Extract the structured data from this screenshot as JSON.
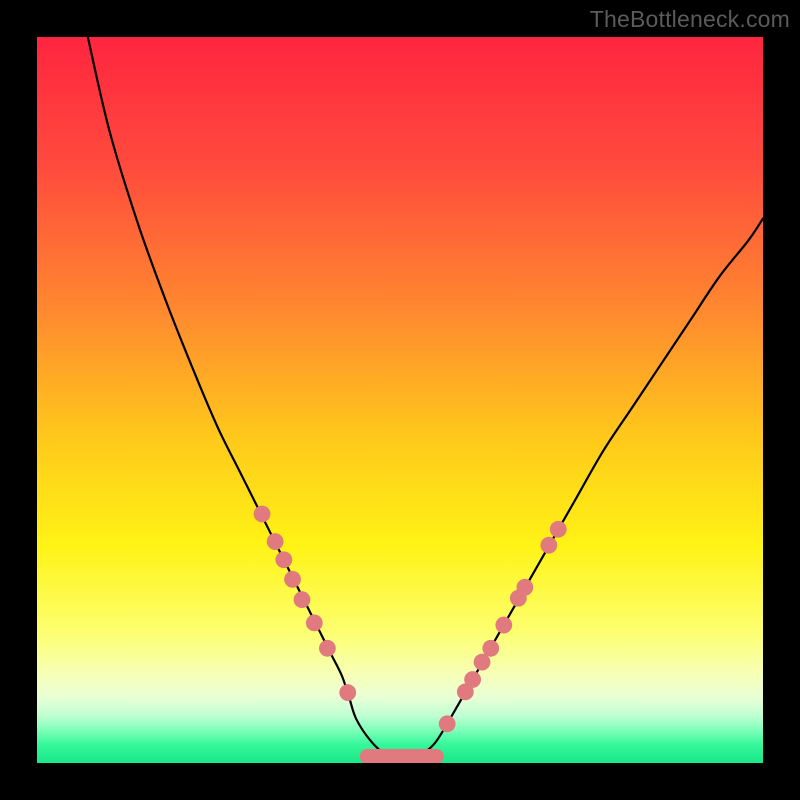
{
  "watermark": "TheBottleneck.com",
  "colors": {
    "black": "#000000",
    "curve": "#000000",
    "marker_fill": "#e07a7e",
    "marker_stroke": "#cf6b6f"
  },
  "gradient_stops": [
    {
      "pct": 0,
      "color": "#ff253f"
    },
    {
      "pct": 18,
      "color": "#ff4b3d"
    },
    {
      "pct": 38,
      "color": "#ff8a2f"
    },
    {
      "pct": 55,
      "color": "#ffc81b"
    },
    {
      "pct": 70,
      "color": "#fff315"
    },
    {
      "pct": 82,
      "color": "#fdff70"
    },
    {
      "pct": 88,
      "color": "#f6ffb9"
    },
    {
      "pct": 91,
      "color": "#e8ffd6"
    },
    {
      "pct": 93.5,
      "color": "#bfffd2"
    },
    {
      "pct": 95.5,
      "color": "#7dffb8"
    },
    {
      "pct": 97.5,
      "color": "#35f79a"
    },
    {
      "pct": 100,
      "color": "#19e889"
    }
  ],
  "chart_data": {
    "type": "line",
    "title": "",
    "xlabel": "",
    "ylabel": "",
    "xlim": [
      0,
      100
    ],
    "ylim": [
      0,
      100
    ],
    "series": [
      {
        "name": "curve",
        "x": [
          7,
          10,
          14,
          18,
          22,
          25,
          28,
          31,
          33,
          35,
          37,
          39,
          40.5,
          42,
          43,
          44,
          46,
          48,
          50,
          52,
          53,
          55,
          58,
          62,
          66,
          70,
          74,
          78,
          82,
          86,
          90,
          94,
          98,
          100
        ],
        "values": [
          100,
          87,
          74,
          63,
          53,
          46,
          40,
          34,
          30,
          26,
          22,
          18,
          15,
          12,
          9,
          6,
          3,
          1.2,
          0.6,
          0.6,
          1.2,
          3,
          8,
          15,
          22,
          29,
          36,
          43,
          49,
          55,
          61,
          67,
          72,
          75
        ]
      }
    ],
    "markers_left": [
      {
        "x": 31.0,
        "y": 34.3
      },
      {
        "x": 32.8,
        "y": 30.5
      },
      {
        "x": 34.0,
        "y": 28.0
      },
      {
        "x": 35.2,
        "y": 25.3
      },
      {
        "x": 36.5,
        "y": 22.5
      },
      {
        "x": 38.2,
        "y": 19.3
      },
      {
        "x": 40.0,
        "y": 15.8
      },
      {
        "x": 42.8,
        "y": 9.7
      }
    ],
    "markers_right": [
      {
        "x": 56.5,
        "y": 5.4
      },
      {
        "x": 59.0,
        "y": 9.8
      },
      {
        "x": 60.0,
        "y": 11.5
      },
      {
        "x": 61.3,
        "y": 13.9
      },
      {
        "x": 62.5,
        "y": 15.8
      },
      {
        "x": 64.3,
        "y": 19.0
      },
      {
        "x": 66.3,
        "y": 22.7
      },
      {
        "x": 67.2,
        "y": 24.2
      },
      {
        "x": 70.5,
        "y": 30.0
      },
      {
        "x": 71.8,
        "y": 32.2
      }
    ],
    "plateau": {
      "x0": 45.5,
      "x1": 55.0,
      "y": 0.9
    }
  }
}
